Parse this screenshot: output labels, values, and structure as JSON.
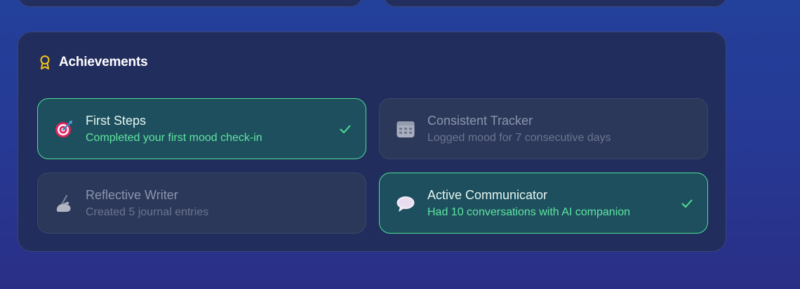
{
  "achievements": {
    "title": "Achievements",
    "icon": "award-ribbon-icon",
    "accent_color": "#f5c518",
    "earned_border_color": "#4fe092",
    "items": [
      {
        "title": "First Steps",
        "description": "Completed your first mood check-in",
        "icon": "target-dart-icon",
        "earned": true
      },
      {
        "title": "Consistent Tracker",
        "description": "Logged mood for 7 consecutive days",
        "icon": "calendar-icon",
        "earned": false
      },
      {
        "title": "Reflective Writer",
        "description": "Created 5 journal entries",
        "icon": "writing-hand-icon",
        "earned": false
      },
      {
        "title": "Active Communicator",
        "description": "Had 10 conversations with AI companion",
        "icon": "speech-bubble-icon",
        "earned": true
      }
    ]
  }
}
